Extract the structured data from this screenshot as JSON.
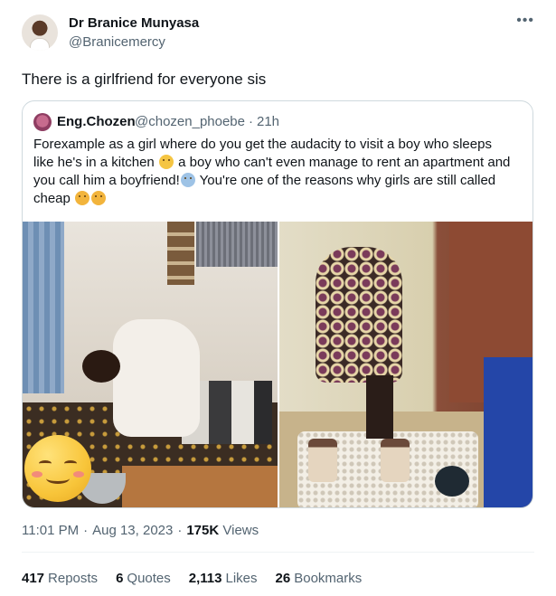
{
  "author": {
    "name": "Dr Branice Munyasa",
    "handle": "@Branicemercy"
  },
  "more_icon": "more-horizontal-icon",
  "tweet_text": "There is a girlfriend for everyone sis",
  "quoted": {
    "name": "Eng.Chozen",
    "handle": "@chozen_phoebe",
    "separator": "·",
    "time": "21h",
    "text_1": "Forexample as a girl where do you get the audacity to visit a boy who sleeps like he's in a kitchen",
    "text_2": "a boy who can't even manage to rent an apartment and you call him a boyfriend!",
    "text_3": "You're one of the reasons why girls are still called cheap",
    "emojis": [
      "raised-eyebrow-emoji",
      "fearful-crying-emoji",
      "pleading-face-emoji",
      "pleading-face-emoji",
      "smiling-blush-emoji"
    ]
  },
  "meta": {
    "time": "11:01 PM",
    "separator": "·",
    "date": "Aug 13, 2023",
    "views_count": "175K",
    "views_label": "Views"
  },
  "stats": {
    "reposts_count": "417",
    "reposts_label": "Reposts",
    "quotes_count": "6",
    "quotes_label": "Quotes",
    "likes_count": "2,113",
    "likes_label": "Likes",
    "bookmarks_count": "26",
    "bookmarks_label": "Bookmarks"
  },
  "colors": {
    "text_primary": "#0f1419",
    "text_secondary": "#536471",
    "border": "#cfd9de"
  }
}
